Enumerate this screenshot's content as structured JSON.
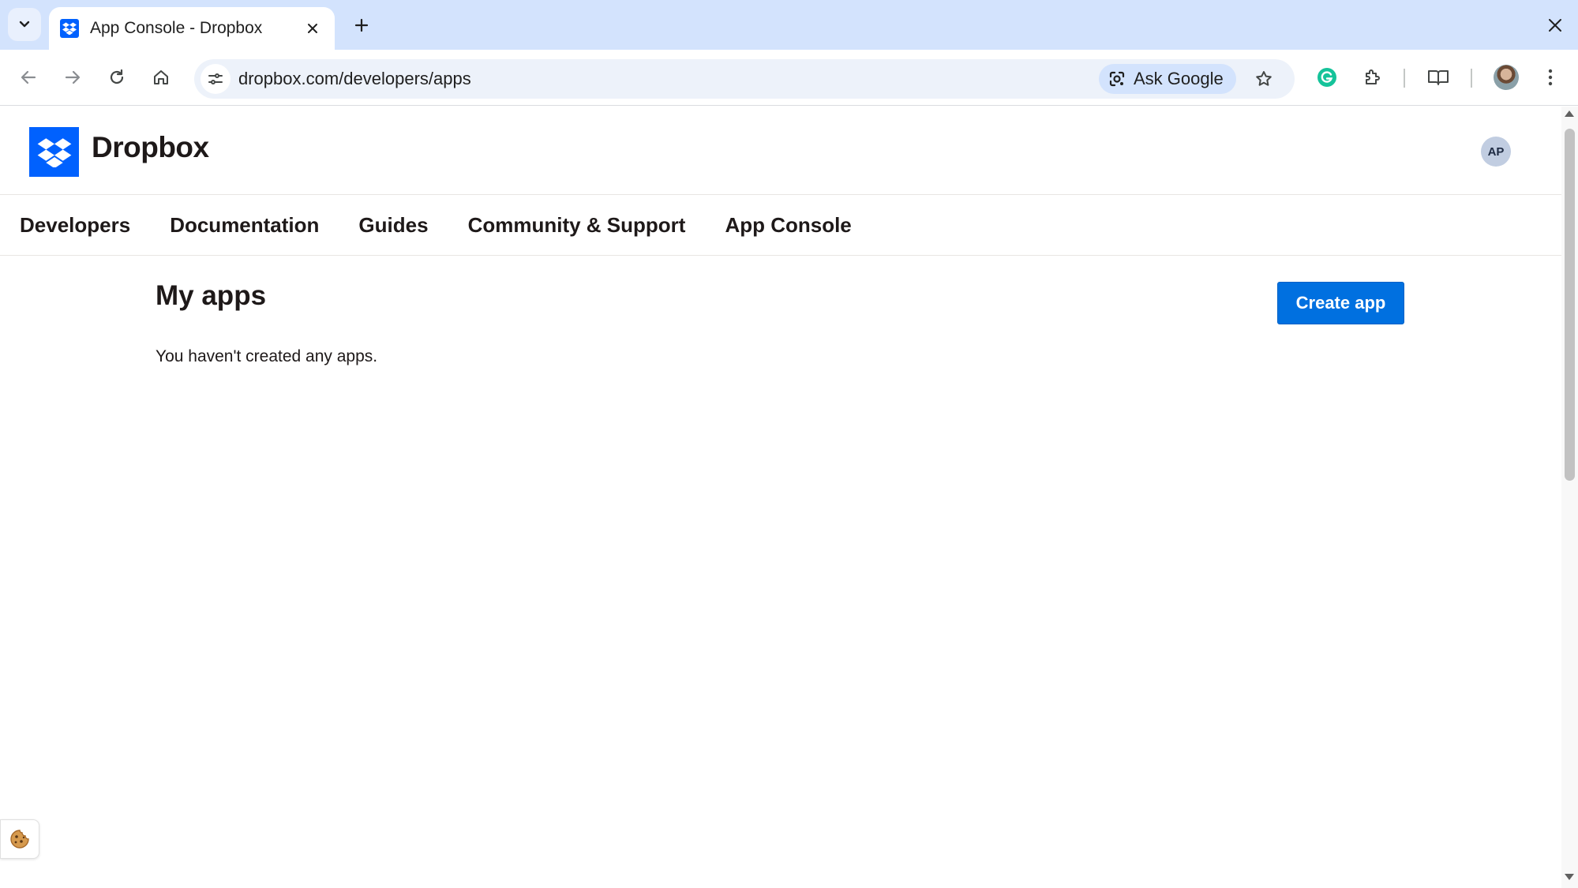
{
  "browser": {
    "tab_title": "App Console - Dropbox",
    "url": "dropbox.com/developers/apps",
    "ask_google_label": "Ask Google"
  },
  "header": {
    "logo_text": "Dropbox",
    "user_initials": "AP"
  },
  "nav": {
    "items": [
      "Developers",
      "Documentation",
      "Guides",
      "Community & Support",
      "App Console"
    ]
  },
  "main": {
    "title": "My apps",
    "empty_message": "You haven't created any apps.",
    "create_button_label": "Create app"
  },
  "colors": {
    "brand_blue": "#0061fe",
    "button_blue": "#0070e0",
    "tabstrip": "#d3e3fd"
  },
  "icons": {
    "cookie": "cookie-icon"
  }
}
